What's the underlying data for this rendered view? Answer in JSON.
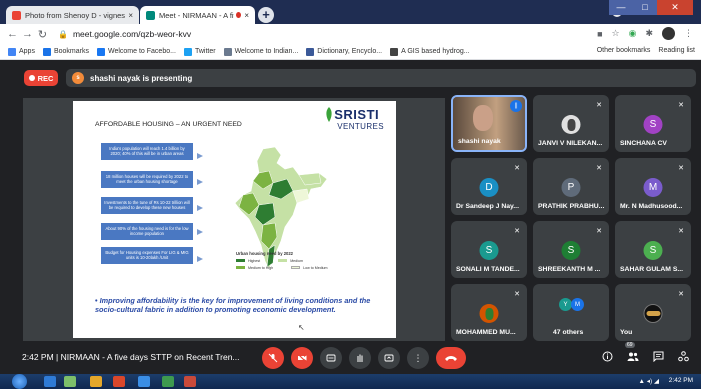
{
  "browser": {
    "tabs": [
      {
        "label": "Photo from Shenoy D - vignesh...",
        "close": "×"
      },
      {
        "label": "Meet - NIRMAAN - A five da",
        "close": "×"
      }
    ],
    "new_tab": "+",
    "url": "meet.google.com/qzb-weor-kvv",
    "window_buttons": {
      "minimize": "—",
      "maximize": "□",
      "close": "✕"
    },
    "bookmarks": [
      {
        "label": "Apps",
        "color": "#4285f4"
      },
      {
        "label": "Bookmarks",
        "color": "#1a73e8"
      },
      {
        "label": "Welcome to Facebo...",
        "color": "#1877f2"
      },
      {
        "label": "Twitter",
        "color": "#1da1f2"
      },
      {
        "label": "Welcome to Indian...",
        "color": "#6b7a8f"
      },
      {
        "label": "Dictionary, Encyclo...",
        "color": "#3b5998"
      },
      {
        "label": "A GIS based hydrog...",
        "color": "#444444"
      }
    ],
    "bookmarks_right": [
      "Other bookmarks",
      "Reading list"
    ]
  },
  "meet": {
    "rec_label": "REC",
    "presenter_initial": "s",
    "presenting_text": "shashi nayak is presenting",
    "meeting_time": "2:42 PM",
    "meeting_sep": "|",
    "meeting_title": "NIRMAAN - A five days STTP on Recent Tren...",
    "participant_count_badge": "69",
    "participants": [
      {
        "name": "shashi nayak",
        "type": "video"
      },
      {
        "name": "JANVI V NILEKAN...",
        "type": "photo"
      },
      {
        "name": "SINCHANA CV",
        "initial": "S",
        "color": "#a142c4"
      },
      {
        "name": "Dr Sandeep J Nay...",
        "initial": "D",
        "color": "#1a8fc4"
      },
      {
        "name": "PRATHIK PRABHU...",
        "initial": "P",
        "color": "#5f6b7a"
      },
      {
        "name": "Mr. N Madhusood...",
        "initial": "M",
        "color": "#7a5ccc"
      },
      {
        "name": "SONALI M TANDE...",
        "initial": "S",
        "color": "#1a9a8f"
      },
      {
        "name": "SHREEKANTH M ...",
        "initial": "S",
        "color": "#1e7e34"
      },
      {
        "name": "SAHAR GULAM S...",
        "initial": "S",
        "color": "#4caf50"
      },
      {
        "name": "MOHAMMED MU...",
        "type": "photo"
      },
      {
        "name": "47 others",
        "minis": [
          "Y",
          "M"
        ]
      },
      {
        "name": "You",
        "type": "self"
      }
    ]
  },
  "slide": {
    "title": "AFFORDABLE HOUSING – AN URGENT NEED",
    "logo_main": "SRISTI",
    "logo_sub": "VENTURES",
    "boxes": [
      "India's population will reach 1.4 billion by 2020; 40% of this will be in urban areas",
      "18 million houses will be required by 2022 to meet the urban housing shortage",
      "Investments to the tune of Rs 10-22 trillion will be required to develop these new houses",
      "About 90% of the housing need is for the low income population",
      "Budget for Housing expenses For LIG & MIG units is 10-20lakh /Unit"
    ],
    "legend_title": "Urban housing need by 2022",
    "legend": [
      {
        "label": "Highest",
        "color": "#2e7d32"
      },
      {
        "label": "Medium",
        "color": "#c5e1a5"
      },
      {
        "label": "Medium to High",
        "color": "#7cb342"
      },
      {
        "label": "Low to Medium",
        "color": "#eef7d8"
      }
    ],
    "bullet": "Improving affordability is the key for improvement of living conditions and the socio-cultural fabric in addition to promoting economic development."
  },
  "taskbar": {
    "clock": "2:42 PM"
  }
}
